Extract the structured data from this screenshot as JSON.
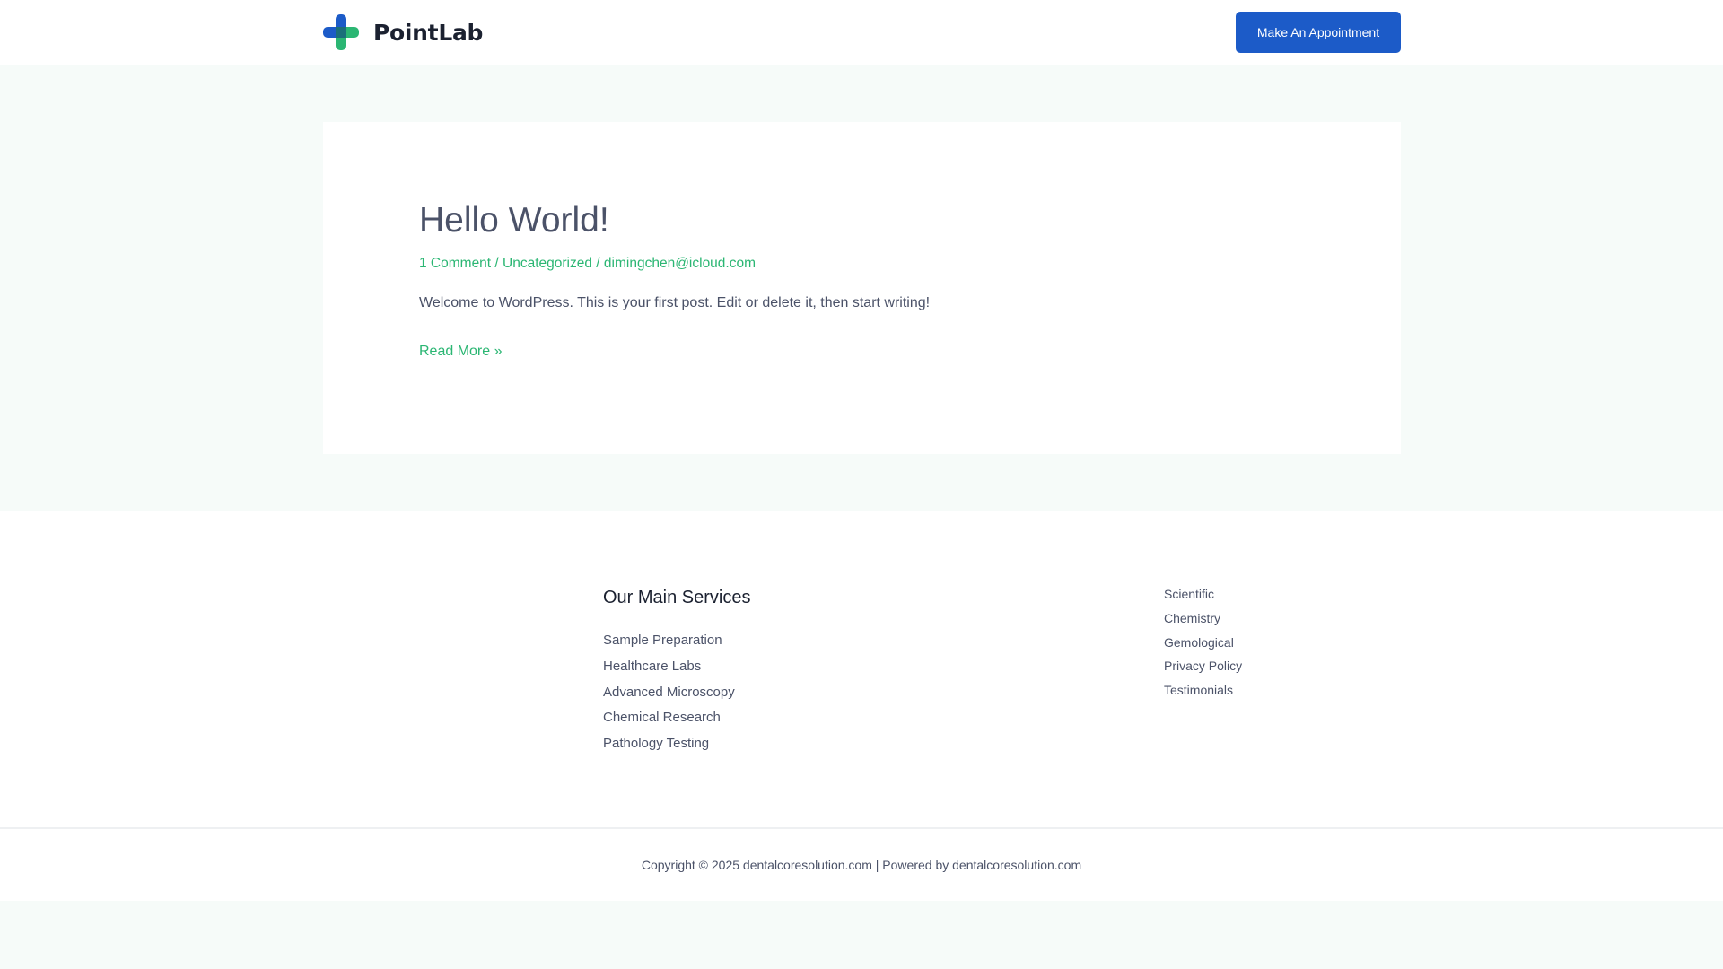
{
  "header": {
    "logo_text": "PointLab",
    "appointment_label": "Make An Appointment"
  },
  "post": {
    "title": "Hello World!",
    "meta": {
      "comments": "1 Comment",
      "separator": " / ",
      "category": "Uncategorized",
      "author": "dimingchen@icloud.com"
    },
    "excerpt": "Welcome to WordPress. This is your first post. Edit or delete it, then start writing!",
    "read_more": "Read More »"
  },
  "footer": {
    "services_title": "Our Main Services",
    "services": [
      "Sample Preparation",
      "Healthcare Labs",
      "Advanced Microscopy",
      "Chemical Research",
      "Pathology Testing"
    ],
    "links": [
      "Scientific",
      "Chemistry",
      "Gemological",
      "Privacy Policy",
      "Testimonials"
    ],
    "copyright_prefix": "Copyright © 2025 ",
    "copyright_site": "dentalcoresolution.com",
    "copyright_mid": " | Powered by ",
    "copyright_powered": "dentalcoresolution.com"
  },
  "colors": {
    "brand_blue": "#1c5bc8",
    "accent_green": "#2bb673",
    "page_background": "#f6fbf9"
  }
}
